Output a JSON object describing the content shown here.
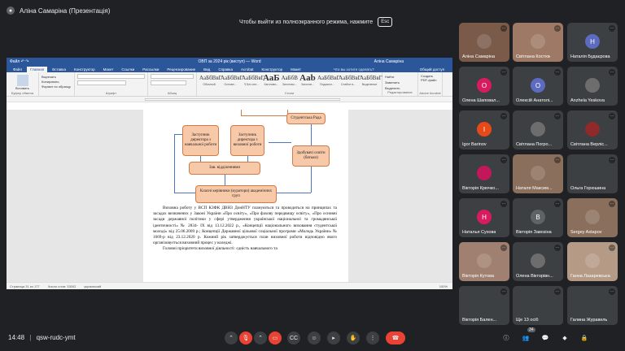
{
  "presenter": {
    "label": "Аліна Самаріна (Презентація)"
  },
  "fullscreen_hint": {
    "text": "Чтобы выйти из полноэкранного режима, нажмите",
    "key": "Esc"
  },
  "word": {
    "title_left": "Файл  ↶  ↷",
    "title_center": "ОВП за 2024 рік (виступ) — Word",
    "title_right": "Аліна Самаріна",
    "tabs": [
      "Файл",
      "Главная",
      "Вставка",
      "Конструктор",
      "Макет",
      "Ссылки",
      "Рассылки",
      "Рецензирование",
      "Вид",
      "Справка",
      "Acrobat",
      "Конструктор",
      "Макет"
    ],
    "active_tab": "Главная",
    "tell_me": "Что вы хотите сделать?",
    "share": "Общий доступ",
    "ribbon": {
      "paste": "Вставить",
      "cut": "Вырезать",
      "copy": "Копировать",
      "format_painter": "Формат по образцу",
      "clipboard_label": "Буфер обмена",
      "font_label": "Шрифт",
      "paragraph_label": "Абзац",
      "styles_label": "Стили",
      "edit_label": "Редактирование",
      "pdf_label": "Adobe Acrobat",
      "find": "Найти",
      "replace": "Заменить",
      "select": "Выделить",
      "create_pdf": "Создать PDF-файл"
    },
    "styles": [
      {
        "sample": "АаБбВвГ",
        "name": "Обычный"
      },
      {
        "sample": "АаБбВвГ",
        "name": "Основн..."
      },
      {
        "sample": "АаБбВвГ",
        "name": "¶ Без инт..."
      },
      {
        "sample": "АаБ",
        "name": "Заголово..."
      },
      {
        "sample": "АаБбВ",
        "name": "Заголово..."
      },
      {
        "sample": "Aab",
        "name": "Заголов..."
      },
      {
        "sample": "АаБбВвГ",
        "name": "Подзагол..."
      },
      {
        "sample": "АаБбВвГ",
        "name": "Слабое в..."
      },
      {
        "sample": "АаБбВвГ",
        "name": "Выделение"
      }
    ],
    "status": {
      "page": "Страница 31 из 177",
      "words": "Число слов: 33002",
      "lang": "украинский",
      "zoom": "100%"
    }
  },
  "diagram": {
    "top_left": "Заступник директора з навчальної роботи",
    "top_mid": "Заступник директора з виховної роботи",
    "top_right": "Студентська Рада",
    "dept": "Зав. відділеннями",
    "health": "Здобувачі освіти (батьки)",
    "curators": "Класні керівники (куратори) академічних груп"
  },
  "document": {
    "para1": "Виховна роботу у ВСП КЗФК ДВНЗ ДонНТУ плануються та проводиться на принципах та засадах визначених у Законі України «Про освіту», «Про фахову передвищу освіту», «Про основні засади державної політики у сфері утвердження української національної та громадянської ідентичності» № 2834- IX від 13.12.2022 р., «Концепції національного виховання студентської молоді» від 25.06.2009 р.; Концепції Державної цільової соціальної програми «Молодь України» № 1669-р від 23.12.2020 р. Кожний рік затверджується план виховної роботи відповідно якого організовується виховний процес у коледжі.",
    "para2": "Головні пріоритети виховної діяльності: єдність навчального та"
  },
  "participants": [
    {
      "name": "Аліна Самаріна",
      "initial": "",
      "color": "#7a5a48",
      "video": true
    },
    {
      "name": "Світлана Костюк",
      "initial": "",
      "color": "#9e7a66",
      "video": true
    },
    {
      "name": "Наталія Будаєрова",
      "initial": "Н",
      "color": "#5c6bc0",
      "video": false
    },
    {
      "name": "Олена Шаповал...",
      "initial": "О",
      "color": "#d81b60",
      "video": false
    },
    {
      "name": "Олексій Анатолі...",
      "initial": "О",
      "color": "#5c6bc0",
      "video": false
    },
    {
      "name": "Anzhela Yeskova",
      "initial": "",
      "color": "#6d6d6d",
      "video": false
    },
    {
      "name": "Igor Barinov",
      "initial": "I",
      "color": "#e64a19",
      "video": false
    },
    {
      "name": "Світлана Погро...",
      "initial": "",
      "color": "#6d6d6d",
      "video": false
    },
    {
      "name": "Світлана Верліс...",
      "initial": "",
      "color": "#8e2a2a",
      "video": false
    },
    {
      "name": "Вікторія Крючко...",
      "initial": "",
      "color": "#c2185b",
      "video": false
    },
    {
      "name": "Наталя Максим...",
      "initial": "",
      "color": "#8a6f5c",
      "video": true
    },
    {
      "name": "Ольга Горюшина",
      "initial": "",
      "color": "#3c4043",
      "video": false
    },
    {
      "name": "Наталья Сухова",
      "initial": "Н",
      "color": "#d81b60",
      "video": false
    },
    {
      "name": "Вікторія Завозіна",
      "initial": "В",
      "color": "#5f6368",
      "video": false
    },
    {
      "name": "Sergey Astapov",
      "initial": "",
      "color": "#8a6f5c",
      "video": true
    },
    {
      "name": "Вікторія Кутова",
      "initial": "",
      "color": "#a08070",
      "video": true
    },
    {
      "name": "Олена Вікторівн...",
      "initial": "",
      "color": "#6d6d6d",
      "video": false
    },
    {
      "name": "Ганна Лазаревська",
      "initial": "",
      "color": "#b59a86",
      "video": true
    },
    {
      "name": "Вікторія Бален...",
      "initial": "",
      "color": "#3c4043",
      "video": false
    },
    {
      "name": "Ще 13 осіб",
      "initial": "",
      "color": "#3c4043",
      "video": false
    },
    {
      "name": "Галина Журавель",
      "initial": "",
      "color": "#3c4043",
      "video": false
    }
  ],
  "bottom": {
    "time": "14:48",
    "meeting_code": "qsw-rudc-ymt",
    "people_count": "34"
  }
}
